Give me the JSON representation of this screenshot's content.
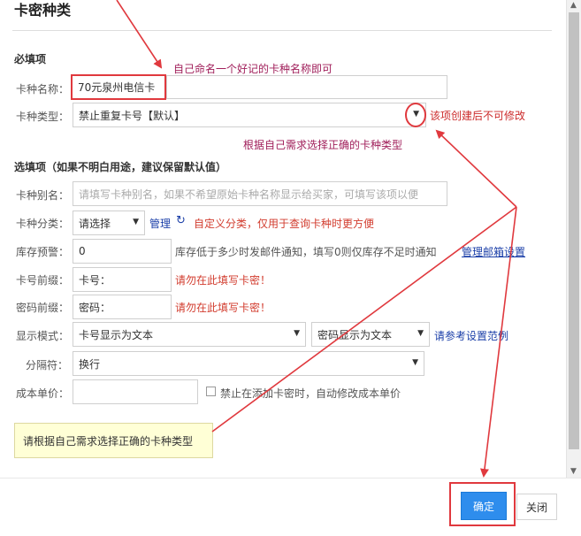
{
  "dialog": {
    "title": "卡密种类"
  },
  "required_section": {
    "heading": "必填项",
    "card_name": {
      "label": "卡种名称：",
      "value": "70元泉州电信卡",
      "annotation": "自己命名一个好记的卡种名称即可"
    },
    "card_type": {
      "label": "卡种类型：",
      "value": "禁止重复卡号【默认】",
      "annotation": "该项创建后不可修改",
      "note": "根据自己需求选择正确的卡种类型"
    }
  },
  "optional_section": {
    "heading": "选填项（如果不明白用途，建议保留默认值）",
    "alias": {
      "label": "卡种别名：",
      "placeholder": "请填写卡种别名，如果不希望原始卡种名称显示给买家，可填写该项以便"
    },
    "category": {
      "label": "卡种分类：",
      "value": "请选择",
      "manage_link": "管理",
      "hint": "自定义分类，仅用于查询卡种时更方便"
    },
    "stock_alert": {
      "label": "库存预警：",
      "value": "0",
      "hint": "库存低于多少时发邮件通知，填写0则仅库存不足时通知",
      "link": "管理邮箱设置"
    },
    "card_prefix": {
      "label": "卡号前缀：",
      "value": "卡号：",
      "warning": "请勿在此填写卡密！"
    },
    "password_prefix": {
      "label": "密码前缀：",
      "value": "密码：",
      "warning": "请勿在此填写卡密！"
    },
    "display_mode": {
      "label": "显示模式：",
      "card_value": "卡号显示为文本",
      "password_value": "密码显示为文本",
      "link": "请参考设置范例"
    },
    "separator": {
      "label": "分隔符：",
      "value": "换行"
    },
    "unit_cost": {
      "label": "成本单价：",
      "value": "",
      "checkbox_label": "禁止在添加卡密时，自动修改成本单价"
    }
  },
  "tip": "请根据自己需求选择正确的卡种类型",
  "footer": {
    "ok_label": "确定",
    "close_label": "关闭"
  },
  "icons": {
    "caret": "▼",
    "refresh": "↻",
    "scroll_up": "▲",
    "scroll_down": "▼"
  },
  "colors": {
    "primary_button": "#2e8ded",
    "annotation_red": "#e0393e",
    "link_blue": "#1b3fa8",
    "warning_red": "#d23c2e",
    "tip_background": "#ffffd6"
  }
}
